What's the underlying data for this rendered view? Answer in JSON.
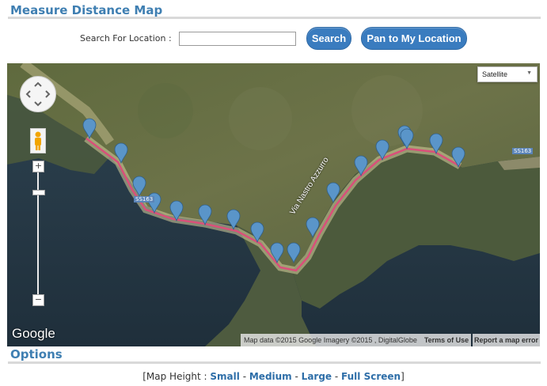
{
  "header": {
    "title": "Measure Distance Map"
  },
  "search": {
    "label": "Search For Location :",
    "value": "",
    "placeholder": "",
    "search_button": "Search",
    "pan_button": "Pan to My Location"
  },
  "map": {
    "map_type": "Satellite",
    "street_label": "Via Nastro Azzurro",
    "road_labels": [
      "SS163",
      "SS163"
    ],
    "google_logo": "Google",
    "attribution": "Map data ©2015 Google Imagery ©2015 , DigitalGlobe",
    "terms": "Terms of Use",
    "report": "Report a map error",
    "marker_count": 18,
    "route_color": "#d9507a",
    "marker_color": "#5a95c9"
  },
  "options": {
    "title": "Options",
    "open_bracket": "[",
    "prefix": "Map Height : ",
    "links": [
      "Small",
      "Medium",
      "Large",
      "Full Screen"
    ],
    "separator": " - ",
    "close_bracket": "]"
  },
  "colors": {
    "accent": "#3f7fb2",
    "button": "#3a7cbf",
    "link": "#2e6ea8"
  }
}
